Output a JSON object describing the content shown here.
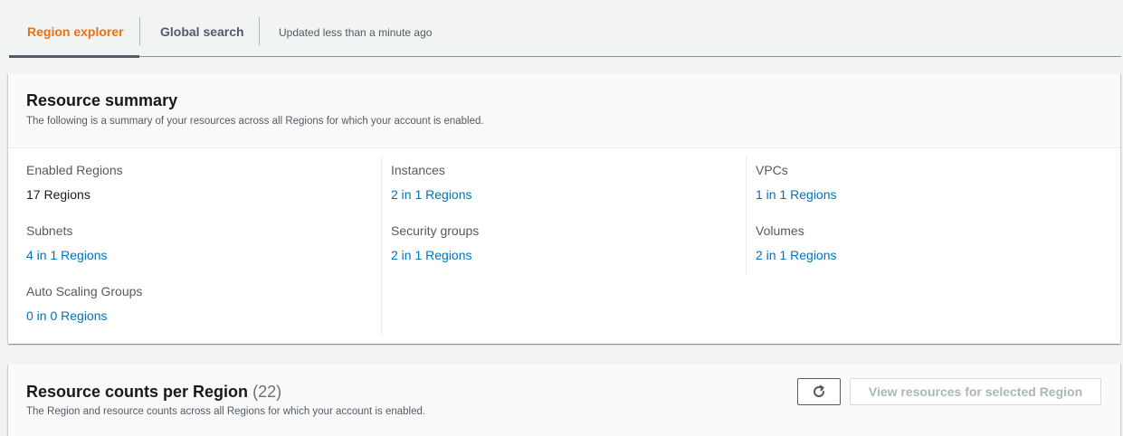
{
  "tabs": [
    {
      "label": "Region explorer",
      "active": true
    },
    {
      "label": "Global search",
      "active": false
    }
  ],
  "updated_text": "Updated less than a minute ago",
  "summary": {
    "title": "Resource summary",
    "description": "The following is a summary of your resources across all Regions for which your account is enabled.",
    "columns": [
      [
        {
          "label": "Enabled Regions",
          "value": "17 Regions",
          "link": false
        },
        {
          "label": "Subnets",
          "value": "4 in 1 Regions",
          "link": true
        },
        {
          "label": "Auto Scaling Groups",
          "value": "0 in 0 Regions",
          "link": true
        }
      ],
      [
        {
          "label": "Instances",
          "value": "2 in 1 Regions",
          "link": true
        },
        {
          "label": "Security groups",
          "value": "2 in 1 Regions",
          "link": true
        }
      ],
      [
        {
          "label": "VPCs",
          "value": "1 in 1 Regions",
          "link": true
        },
        {
          "label": "Volumes",
          "value": "2 in 1 Regions",
          "link": true
        }
      ]
    ]
  },
  "counts": {
    "title": "Resource counts per Region",
    "count": "(22)",
    "description": "The Region and resource counts across all Regions for which your account is enabled.",
    "view_button_label": "View resources for selected Region",
    "refresh_icon": "refresh-icon"
  },
  "colors": {
    "accent": "#ec7211",
    "link": "#0073bb",
    "disabled": "#aab7b8"
  }
}
